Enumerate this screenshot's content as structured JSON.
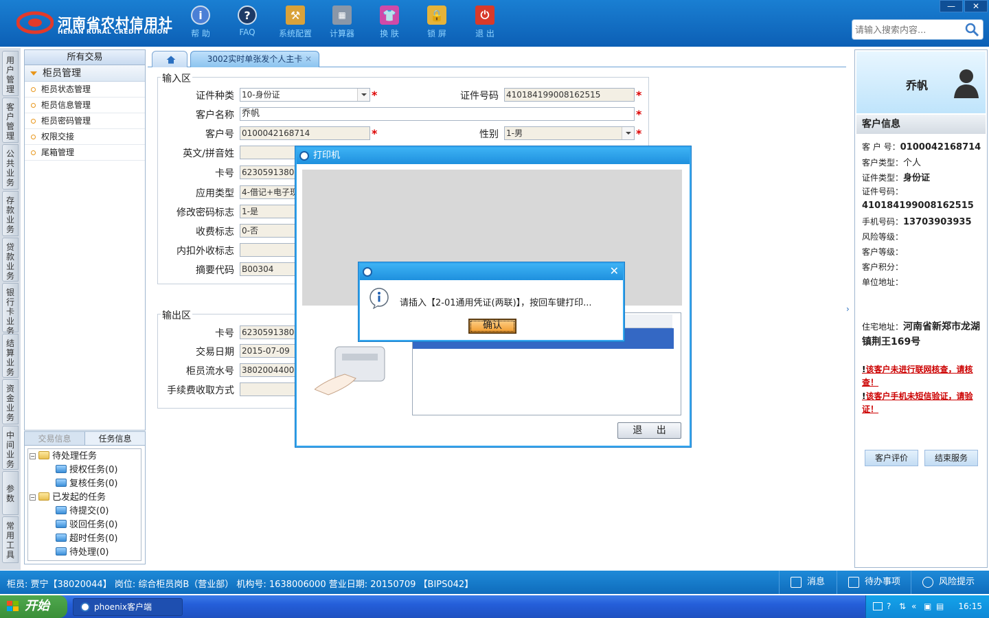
{
  "header": {
    "logo_cn": "河南省农村信用社",
    "logo_en": "HENAN RURAL CREDIT UNION",
    "tools": [
      "帮 助",
      "FAQ",
      "系统配置",
      "计算器",
      "换 肤",
      "锁 屏",
      "退 出"
    ],
    "window_minimize": "—",
    "window_close": "✕",
    "search_placeholder": "请输入搜索内容..."
  },
  "left_tabs": [
    "用户管理",
    "客户管理",
    "公共业务",
    "存款业务",
    "贷款业务",
    "银行卡业务",
    "结算业务",
    "资金业务",
    "中间业务",
    "参数",
    "常用工具"
  ],
  "nav": {
    "title": "所有交易",
    "group": "柜员管理",
    "items": [
      "柜员状态管理",
      "柜员信息管理",
      "柜员密码管理",
      "权限交接",
      "尾箱管理"
    ]
  },
  "tasks": {
    "tab_trade": "交易信息",
    "tab_task": "任务信息",
    "pending": "待处理任务",
    "auth": "授权任务(0)",
    "review": "复核任务(0)",
    "initiated": "已发起的任务",
    "to_submit": "待提交(0)",
    "rejected": "驳回任务(0)",
    "timeout": "超时任务(0)",
    "to_process": "待处理(0)"
  },
  "tab": {
    "active": "3002实时单张发个人主卡",
    "close": "✕"
  },
  "input_area": {
    "legend": "输入区",
    "id_type_label": "证件种类",
    "id_type_value": "10-身份证",
    "id_no_label": "证件号码",
    "id_no_value": "410184199008162515",
    "name_label": "客户名称",
    "name_value": "乔帆",
    "cust_no_label": "客户号",
    "cust_no_value": "0100042168714",
    "gender_label": "性别",
    "gender_value": "1-男",
    "pinyin_label": "英文/拼音姓",
    "pinyin_value": "",
    "card_label": "卡号",
    "card_value": "6230591380000",
    "app_type_label": "应用类型",
    "app_type_value": "4-借记+电子现",
    "pwd_flag_label": "修改密码标志",
    "pwd_flag_value": "1-是",
    "fee_flag_label": "收费标志",
    "fee_flag_value": "0-否",
    "deduct_label": "内扣外收标志",
    "deduct_value": "",
    "summary_label": "摘要代码",
    "summary_value": "B00304",
    "required": "*"
  },
  "output_area": {
    "legend": "输出区",
    "card_label": "卡号",
    "card_value": "6230591380000",
    "date_label": "交易日期",
    "date_value": "2015-07-09",
    "serial_label": "柜员流水号",
    "serial_value": "3802004400000",
    "fee_method_label": "手续费收取方式",
    "fee_method_value": ""
  },
  "customer": {
    "name": "乔帆",
    "section": "客户信息",
    "cust_no_label": "客 户 号：",
    "cust_no": "0100042168714",
    "type_label": "客户类型：",
    "type": "个人",
    "id_type_label": "证件类型：",
    "id_type": "身份证",
    "id_no_label": "证件号码：",
    "id_no": "410184199008162515",
    "phone_label": "手机号码：",
    "phone": "13703903935",
    "risk_label": "风险等级：",
    "level_label": "客户等级：",
    "points_label": "客户积分：",
    "company_label": "单位地址：",
    "home_label": "住宅地址：",
    "home": "河南省新郑市龙湖镇荆王169号",
    "warn1": "该客户未进行联网核查，请核查！",
    "warn2": "该客户手机未短信验证，请验证！",
    "warn_mark": "!",
    "btn_eval": "客户评价",
    "btn_end": "结束服务"
  },
  "status": {
    "text": "柜员: 贾宁【38020044】 岗位: 综合柜员岗B（营业部） 机构号: 1638006000  营业日期: 20150709  【BIPS042】",
    "msg": "消息",
    "todo": "待办事项",
    "risk": "风险提示"
  },
  "taskbar": {
    "start": "开始",
    "app": "phoenix客户端",
    "clock": "16:15"
  },
  "print_dialog": {
    "title": "打印机",
    "exit": "退 出"
  },
  "msg_dialog": {
    "message": "请插入【2-01通用凭证(两联)】，按回车键打印...",
    "ok": "确认",
    "close": "✕"
  },
  "colors": {
    "header": "#1a7fd2",
    "accent": "#35a7ef",
    "warning": "#cc0000",
    "ok_button": "#f09a2c"
  }
}
